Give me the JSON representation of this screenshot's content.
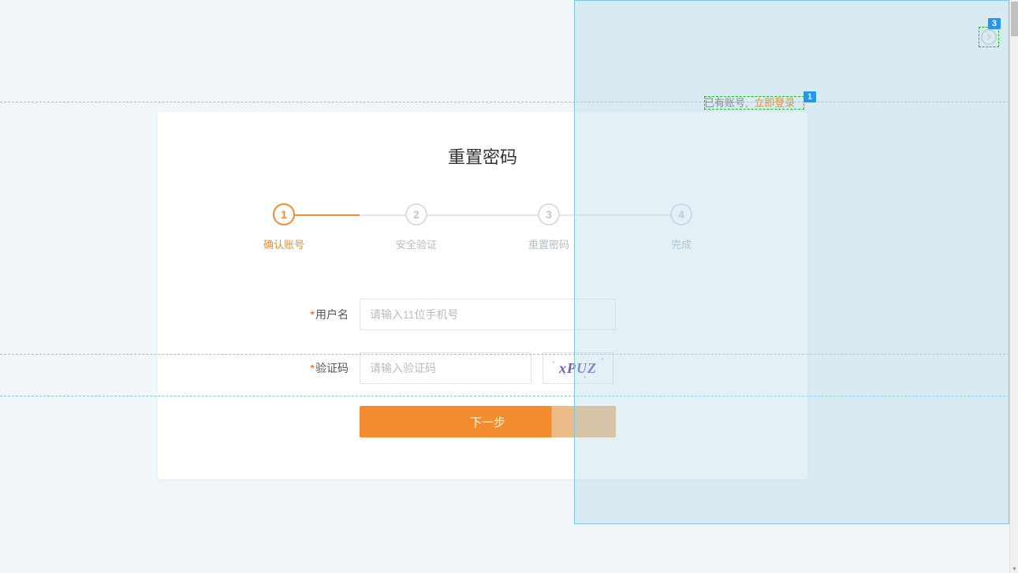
{
  "badges": {
    "topRight": "3",
    "nearLogin": "1"
  },
  "loginRow": {
    "haveAccount": "已有账号,",
    "goLogin": "立即登录"
  },
  "card": {
    "title": "重置密码",
    "steps": [
      {
        "num": "1",
        "label": "确认账号",
        "active": true
      },
      {
        "num": "2",
        "label": "安全验证",
        "active": false
      },
      {
        "num": "3",
        "label": "重置密码",
        "active": false
      },
      {
        "num": "4",
        "label": "完成",
        "active": false
      }
    ],
    "progressFraction": 0.19,
    "form": {
      "usernameLabel": "用户名",
      "usernamePlaceholder": "请输入11位手机号",
      "codeLabel": "验证码",
      "codePlaceholder": "请输入验证码",
      "captchaValue": "xPUZ",
      "nextButton": "下一步"
    }
  }
}
